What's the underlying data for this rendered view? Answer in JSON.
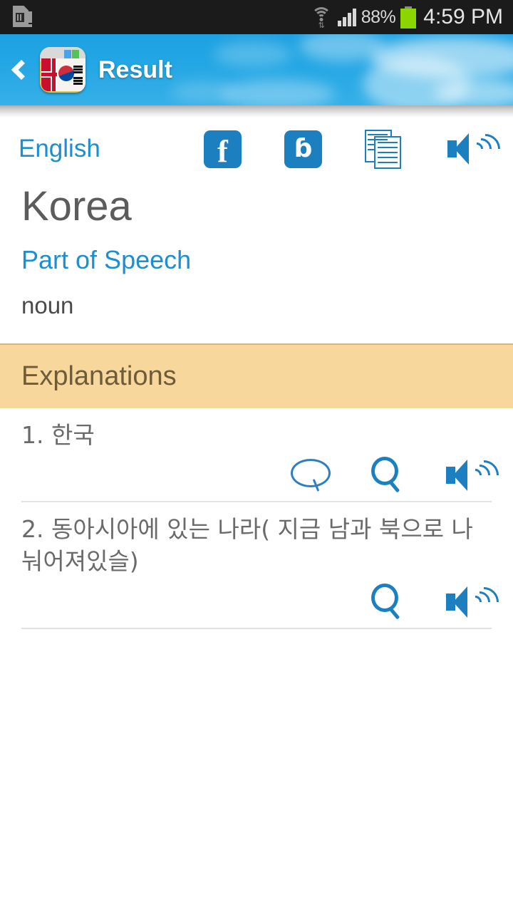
{
  "status_bar": {
    "sim_icon": "sim-card-alert-icon",
    "wifi_icon": "wifi-icon",
    "signal_icon": "cellular-signal-icon",
    "battery_percent": "88%",
    "battery_icon": "battery-icon",
    "time": "4:59 PM"
  },
  "app_bar": {
    "back_icon": "back-chevron-icon",
    "app_icon": "dictionary-app-icon",
    "title": "Result"
  },
  "share_row": {
    "language_label": "English",
    "actions": [
      {
        "name": "facebook-share-button",
        "icon": "facebook-icon",
        "glyph": "f"
      },
      {
        "name": "twitter-share-button",
        "icon": "twitter-icon",
        "glyph": "ɓ"
      },
      {
        "name": "copy-button",
        "icon": "copy-documents-icon"
      },
      {
        "name": "speak-button",
        "icon": "speaker-icon"
      }
    ]
  },
  "word": {
    "headword": "Korea",
    "part_of_speech_label": "Part of Speech",
    "part_of_speech_value": "noun"
  },
  "explanations": {
    "banner_title": "Explanations",
    "items": [
      {
        "number": "1.",
        "text": "한국",
        "full": "1. 한국",
        "actions": [
          "comment-icon",
          "search-icon",
          "speaker-icon"
        ]
      },
      {
        "number": "2.",
        "text": "동아시아에 있는 나라( 지금 남과 북으로 나눠어져있슬)",
        "full": "2. 동아시아에 있는 나라( 지금 남과 북으로 나눠어져있슬)",
        "actions": [
          "search-icon",
          "speaker-icon"
        ]
      }
    ]
  },
  "colors": {
    "status_bar_bg": "#1b1b1b",
    "app_bar_blue": "#23a6e4",
    "accent_blue": "#1b8fd0",
    "icon_blue": "#1b7fc0",
    "banner_bg": "#f7d79b",
    "banner_text": "#6e5c39",
    "headword_gray": "#5c5c5c",
    "body_gray": "#6a6a6a",
    "divider": "#e3e3e3",
    "battery_green": "#8cd600"
  }
}
